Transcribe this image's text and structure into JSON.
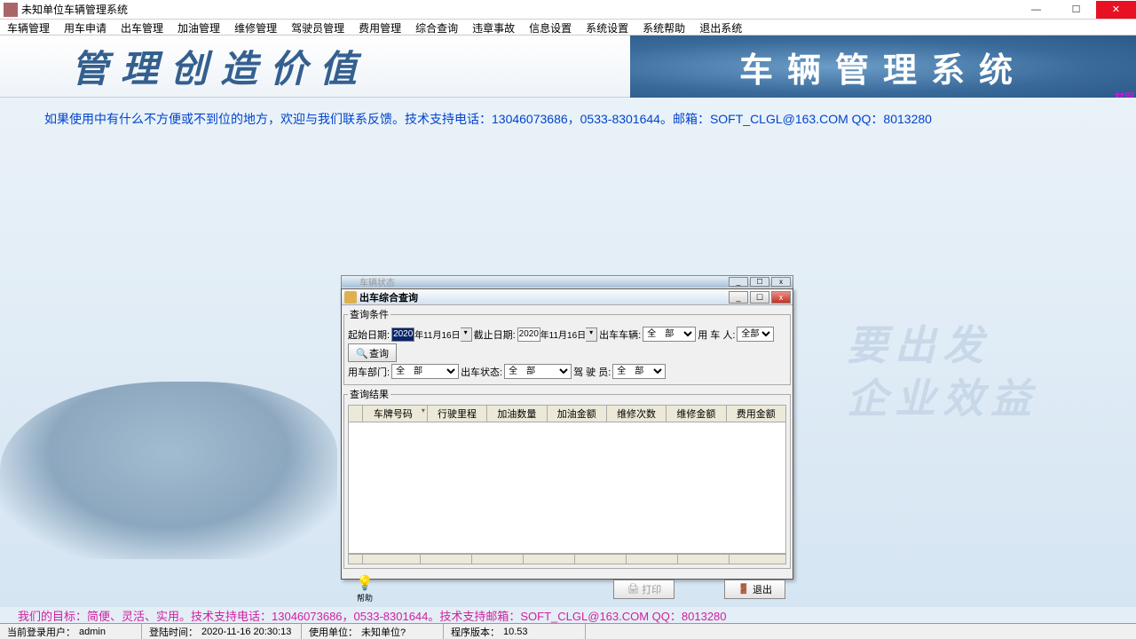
{
  "window": {
    "title": "未知单位车辆管理系统"
  },
  "winbtns": {
    "min": "—",
    "max": "☐",
    "close": "✕"
  },
  "menu": [
    "车辆管理",
    "用车申请",
    "出车管理",
    "加油管理",
    "维修管理",
    "驾驶员管理",
    "费用管理",
    "综合查询",
    "违章事故",
    "信息设置",
    "系统设置",
    "系统帮助",
    "退出系统"
  ],
  "banner": {
    "left": "管理创造价值",
    "right": "车辆管理系统",
    "corner": "村网"
  },
  "notice": "如果使用中有什么不方便或不到位的地方，欢迎与我们联系反馈。技术支持电话：13046073686，0533-8301644。邮箱：SOFT_CLGL@163.COM QQ：8013280",
  "bgline1": "要出发",
  "bgline2": "企业效益",
  "backwin": {
    "title": "车辆状态"
  },
  "dlg": {
    "title": "出车综合查询",
    "cond_legend": "查询条件",
    "start_label": "起始日期:",
    "start_year": "2020",
    "start_rest": "年11月16日",
    "end_label": "截止日期:",
    "end_year": "2020",
    "end_rest": "年11月16日",
    "car_label": "出车车辆:",
    "car_val": "全　部",
    "person_label": "用 车 人:",
    "person_val": "全部",
    "dept_label": "用车部门:",
    "dept_val": "全　部",
    "status_label": "出车状态:",
    "status_val": "全　部",
    "driver_label": "驾 驶 员:",
    "driver_val": "全　部",
    "search_btn": "查询",
    "res_legend": "查询结果",
    "cols": [
      "车牌号码",
      "行驶里程",
      "加油数量",
      "加油金额",
      "维修次数",
      "维修金额",
      "费用金额"
    ],
    "tip": "帮助",
    "print": "打印",
    "exit": "退出"
  },
  "goal": "我们的目标：简便、灵活、实用。技术支持电话：13046073686，0533-8301644。技术支持邮箱：SOFT_CLGL@163.COM QQ：8013280",
  "status": {
    "user_l": "当前登录用户：",
    "user_v": "admin",
    "login_l": "登陆时间：",
    "login_v": "2020-11-16 20:30:13",
    "unit_l": "使用单位：",
    "unit_v": "未知单位?",
    "ver_l": "程序版本：",
    "ver_v": "10.53"
  }
}
